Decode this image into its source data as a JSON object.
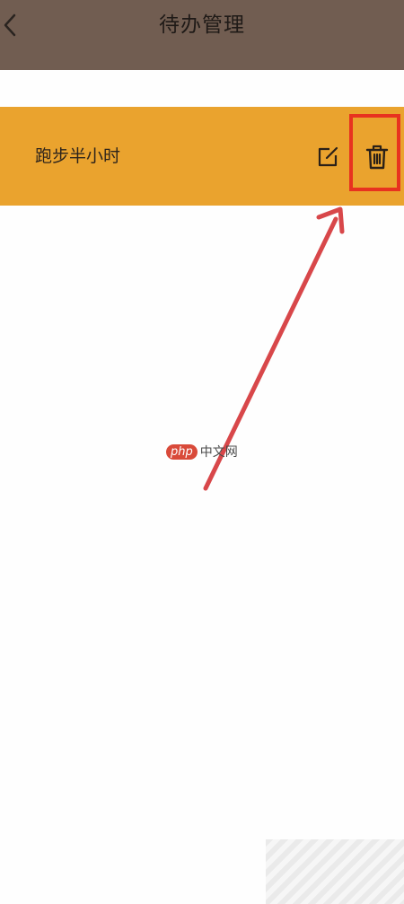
{
  "header": {
    "title": "待办管理",
    "back_icon": "chevron-left-icon",
    "background": "#715d51"
  },
  "todo": {
    "items": [
      {
        "label": "跑步半小时",
        "edit_icon": "edit-icon",
        "delete_icon": "trash-icon"
      }
    ],
    "background": "#eaa32e"
  },
  "annotation": {
    "highlight_color": "#e8321f",
    "arrow_color": "#d8474a"
  },
  "watermark": {
    "logo": "php",
    "text": "中文网"
  }
}
